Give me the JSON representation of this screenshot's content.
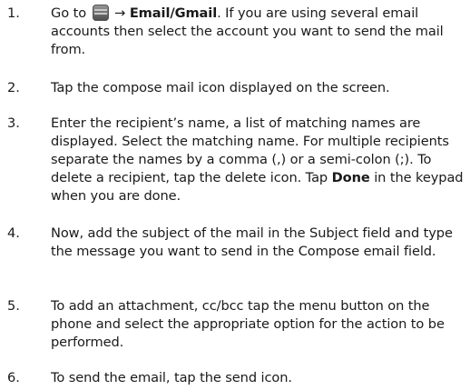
{
  "steps": [
    {
      "number": "1.",
      "part1": "Go to",
      "arrow": "→",
      "bold1": "Email/Gmail",
      "part2": ". If you are using several email accounts then select the account you want to send the mail from.",
      "icon": "app-menu-icon"
    },
    {
      "number": "2.",
      "text": "Tap the compose mail icon displayed on the screen."
    },
    {
      "number": "3.",
      "part1": "Enter the recipient’s name, a list of matching names are displayed. Select the matching name. For multiple recipients separate the names by a comma (,) or a semi-colon (;). To delete a recipient, tap the delete icon. Tap",
      "bold1": "Done",
      "part2": "in the keypad when you are done."
    },
    {
      "number": "4.",
      "text": "Now, add the subject of the mail in the Subject field and type the message you want to send in the Compose email field."
    },
    {
      "number": "5.",
      "text": "To add an attachment, cc/bcc tap the menu button on the phone and select the appropriate option for the action to be performed."
    },
    {
      "number": "6.",
      "text": "To send the email, tap the send icon."
    }
  ]
}
